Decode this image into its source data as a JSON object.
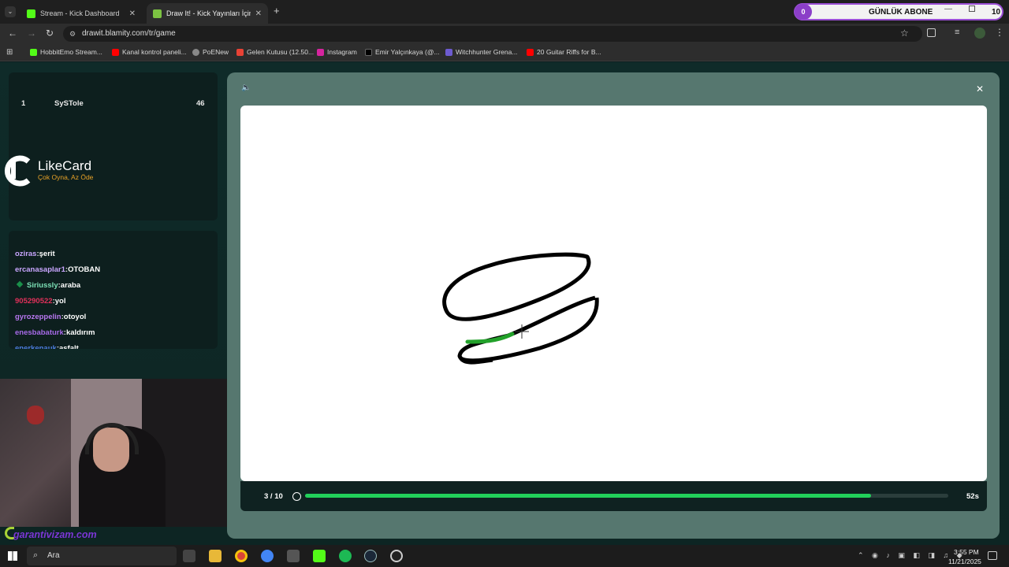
{
  "browser": {
    "tabs": [
      {
        "title": "Stream - Kick Dashboard",
        "active": false
      },
      {
        "title": "Draw It! - Kick Yayınları İçin Çizi",
        "active": true
      }
    ],
    "url": "drawit.blamity.com/tr/game",
    "bookmarks": [
      "HobbitEmo Stream...",
      "Kanal kontrol paneli...",
      "PoENew",
      "Gelen Kutusu (12.50...",
      "Instagram",
      "Emir Yalçınkaya (@...",
      "Witchhunter Grena...",
      "20 Guitar Riffs for B..."
    ]
  },
  "overlay": {
    "sub_count": "0",
    "sub_label": "GÜNLÜK ABONE",
    "sub_goal": "10",
    "likecard_title": "LikeCard",
    "likecard_slogan": "Çok Oyna, Az Öde",
    "watermark": "garantivizam.com"
  },
  "leaderboard": [
    {
      "rank": "1",
      "name": "SySTole",
      "score": "46"
    }
  ],
  "chat": [
    {
      "user": "oziras",
      "msg": "şerit",
      "color": "#c9a6ff"
    },
    {
      "user": "ercanasaplar1",
      "msg": "OTOBAN",
      "color": "#c9a6ff"
    },
    {
      "user": "Siriussly",
      "msg": "araba",
      "color": "#7ce0b6",
      "badge": true
    },
    {
      "user": "905290522",
      "msg": "yol",
      "color": "#e0305a"
    },
    {
      "user": "gyrozeppelin",
      "msg": "otoyol",
      "color": "#b877f0"
    },
    {
      "user": "enesbabaturk",
      "msg": "kaldırım",
      "color": "#a76ae8"
    },
    {
      "user": "enerkenauk",
      "msg": "asfalt",
      "color": "#4d7ee0"
    }
  ],
  "game": {
    "round": "3 / 10",
    "timer": "52s",
    "progress": 0.88
  },
  "taskbar": {
    "search": "Ara",
    "time": "3:55 PM",
    "date": "11/21/2025"
  },
  "colors": {
    "accent": "#21d05a",
    "canvas": "#ffffff"
  }
}
